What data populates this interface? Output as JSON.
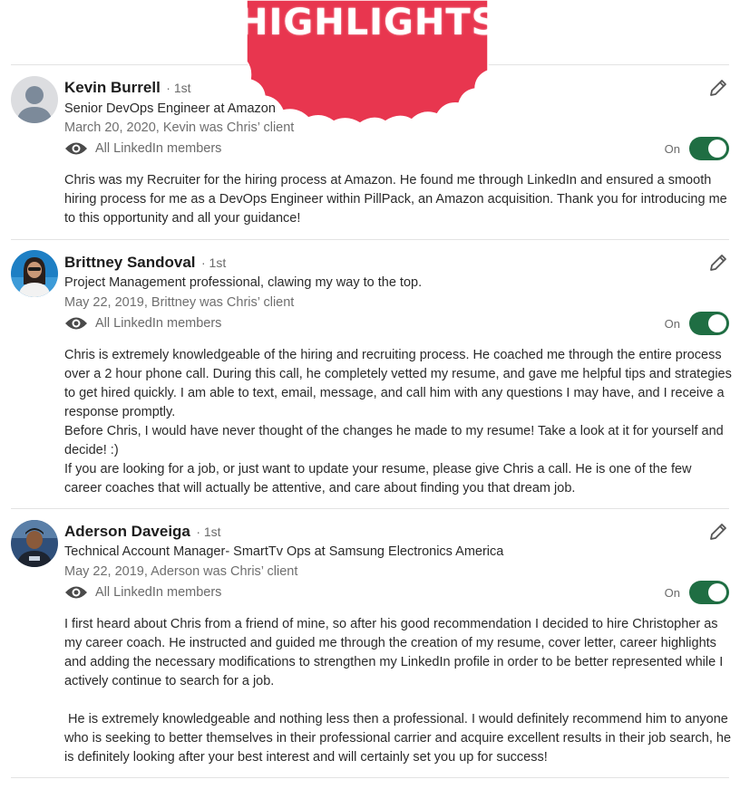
{
  "banner": {
    "text": "HIGHLIGHTS",
    "color": "#e8364f"
  },
  "toggle_color": "#1f6e43",
  "recommendations": [
    {
      "name": "Kevin Burrell",
      "degree": "· 1st",
      "headline": "Senior DevOps Engineer at Amazon",
      "meta": "March 20, 2020, Kevin was Chris’ client",
      "visibility": "All LinkedIn members",
      "toggle": "On",
      "paragraphs": [
        "Chris was my Recruiter for the hiring process at Amazon. He found me through LinkedIn and ensured a smooth hiring process for me as a DevOps Engineer within PillPack, an Amazon acquisition. Thank you for introducing me to this opportunity and all your guidance!"
      ]
    },
    {
      "name": "Brittney Sandoval",
      "degree": "· 1st",
      "headline": "Project Management professional, clawing my way to the top.",
      "meta": "May 22, 2019, Brittney was Chris’ client",
      "visibility": "All LinkedIn members",
      "toggle": "On",
      "paragraphs": [
        "Chris is extremely knowledgeable of the hiring and recruiting process. He coached me through the entire process over a 2 hour phone call. During this call, he completely vetted my resume, and gave me helpful tips and strategies to get hired quickly. I am able to text, email, message, and call him with any questions I may have, and I receive a response promptly.",
        "Before Chris, I would have never thought of the changes he made to my resume! Take a look at it for yourself and decide! :)",
        "If you are looking for a job, or just want to update your resume, please give Chris a call. He is one of the few career coaches that will actually be attentive, and care about finding you that dream job."
      ]
    },
    {
      "name": "Aderson Daveiga",
      "degree": "· 1st",
      "headline": "Technical Account Manager- SmartTv Ops at Samsung Electronics America",
      "meta": "May 22, 2019, Aderson was Chris’ client",
      "visibility": "All LinkedIn members",
      "toggle": "On",
      "paragraphs": [
        "I first heard about Chris from a friend of mine, so after his good recommendation I decided to hire Christopher as my career coach. He instructed and guided me through the creation of my resume, cover letter, career highlights and adding the necessary modifications to strengthen my LinkedIn profile in order to be better represented while I actively continue to search for a job.",
        "",
        " He is extremely knowledgeable and nothing less then a professional. I would definitely recommend him to anyone who is seeking to better themselves in their professional carrier and acquire excellent results in their job search, he is definitely looking after your best interest and will certainly set you up for success!"
      ]
    }
  ]
}
